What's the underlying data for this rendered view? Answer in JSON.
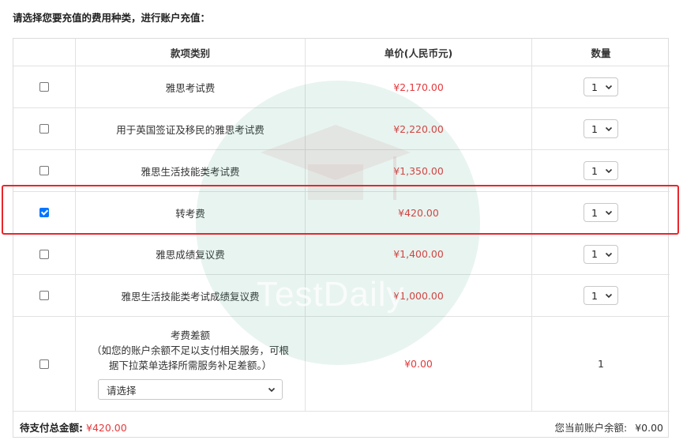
{
  "prompt": "请选择您要充值的费用种类，进行账户充值：",
  "table": {
    "headers": {
      "category": "款项类别",
      "price": "单价(人民币元)",
      "quantity": "数量"
    },
    "rows": [
      {
        "name": "雅思考试费",
        "price": "¥2,170.00",
        "qty": "1",
        "checked": false
      },
      {
        "name": "用于英国签证及移民的雅思考试费",
        "price": "¥2,220.00",
        "qty": "1",
        "checked": false
      },
      {
        "name": "雅思生活技能类考试费",
        "price": "¥1,350.00",
        "qty": "1",
        "checked": false
      },
      {
        "name": "转考费",
        "price": "¥420.00",
        "qty": "1",
        "checked": true
      },
      {
        "name": "雅思成绩复议费",
        "price": "¥1,400.00",
        "qty": "1",
        "checked": false
      },
      {
        "name": "雅思生活技能类考试成绩复议费",
        "price": "¥1,000.00",
        "qty": "1",
        "checked": false
      }
    ],
    "difference": {
      "title": "考费差额",
      "note": "（如您的账户余额不足以支付相关服务，可根据下拉菜单选择所需服务补足差额。）",
      "select_value": "请选择",
      "price": "¥0.00",
      "qty": "1",
      "checked": false
    }
  },
  "footer": {
    "total_label": "待支付总金额:",
    "total_value": "¥420.00",
    "balance_label": "您当前账户余额:",
    "balance_value": "¥0.00"
  },
  "watermark": {
    "text": "TestDaily"
  },
  "colors": {
    "price": "#e4393c",
    "highlight": "#e8262b",
    "checkbox": "#0075ff"
  },
  "icons": {
    "dropdown": "chevron-down-icon",
    "watermark_logo": "graduation-cap-icon"
  }
}
